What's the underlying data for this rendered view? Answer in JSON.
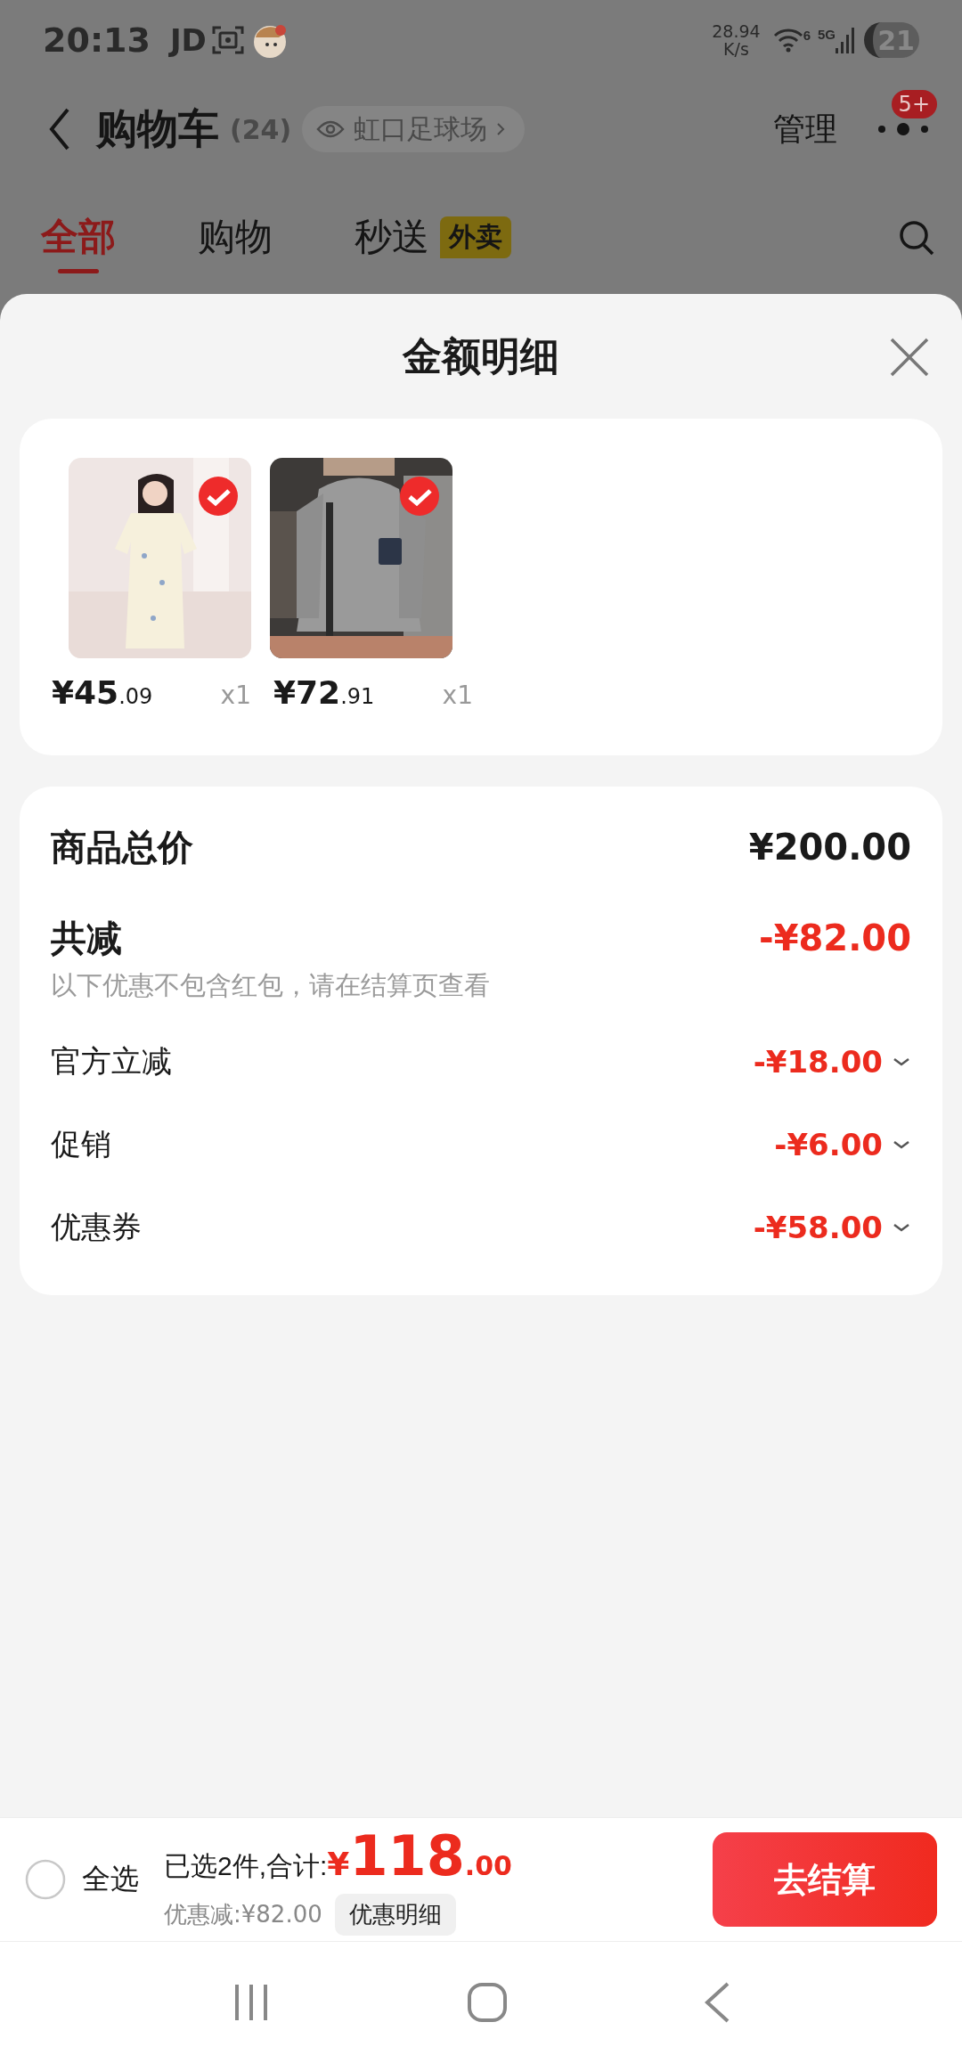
{
  "status_bar": {
    "time": "20:13",
    "carrier": "JD",
    "speed": "28.94",
    "speed_unit": "K/s",
    "wifi_badge": "6",
    "network": "5G",
    "battery": "21"
  },
  "header": {
    "title": "购物车",
    "count": "(24)",
    "location": "虹口足球场",
    "manage": "管理",
    "more_badge": "5+"
  },
  "tabs": [
    {
      "label": "全部",
      "selected": true
    },
    {
      "label": "购物",
      "selected": false
    },
    {
      "label": "秒送",
      "selected": false,
      "tag": "外卖"
    }
  ],
  "sheet": {
    "title": "金额明细"
  },
  "products": [
    {
      "kind": "dress",
      "price_main": "¥45",
      "price_decimal": ".09",
      "quantity": "x1",
      "checked": true
    },
    {
      "kind": "hoodie",
      "price_main": "¥72",
      "price_decimal": ".91",
      "quantity": "x1",
      "checked": true
    }
  ],
  "summary": {
    "total_label": "商品总价",
    "total": "¥200.00",
    "discount_label": "共减",
    "discount": "-¥82.00",
    "note": "以下优惠不包含红包，请在结算页查看",
    "items": [
      {
        "label": "官方立减",
        "amount": "-¥18.00",
        "expanded": false
      },
      {
        "label": "促销",
        "amount": "-¥6.00",
        "expanded": false
      },
      {
        "label": "优惠券",
        "amount": "-¥58.00",
        "expanded": false
      }
    ]
  },
  "checkout_bar": {
    "select_all": {
      "label": "全选",
      "checked": false
    },
    "selected_text": "已选2件,合计:",
    "currency": "¥",
    "total_int": "118",
    "total_dec": ".00",
    "saved": "优惠减:¥82.00",
    "detail_button": "优惠明细",
    "checkout_button": "去结算"
  }
}
